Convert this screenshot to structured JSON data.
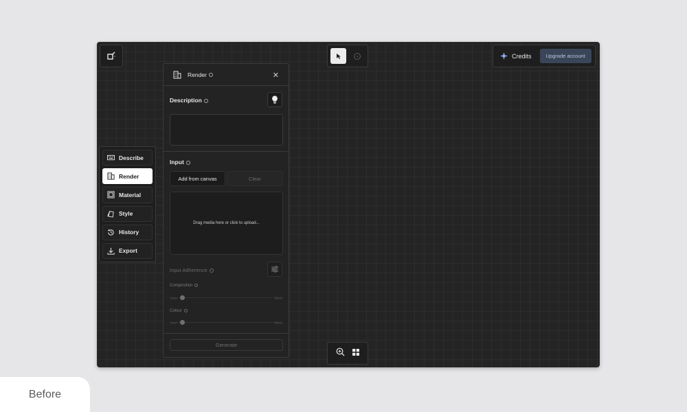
{
  "toolbar": {
    "tools": [
      {
        "name": "cursor-icon",
        "active": true
      },
      {
        "name": "target-icon",
        "active": false
      }
    ]
  },
  "header": {
    "credits_label": "Credits",
    "upgrade_label": "Upgrade account"
  },
  "sidebar": {
    "items": [
      {
        "label": "Describe",
        "icon": "keyboard-icon",
        "active": false
      },
      {
        "label": "Render",
        "icon": "building-icon",
        "active": true
      },
      {
        "label": "Material",
        "icon": "material-icon",
        "active": false
      },
      {
        "label": "Style",
        "icon": "style-icon",
        "active": false
      },
      {
        "label": "History",
        "icon": "history-icon",
        "active": false
      },
      {
        "label": "Export",
        "icon": "download-icon",
        "active": false
      }
    ]
  },
  "panel": {
    "title": "Render",
    "description_label": "Description",
    "description_value": "",
    "input_label": "Input",
    "add_from_canvas": "Add from canvas",
    "clear": "Clear",
    "dropzone_text": "Drag media here or click to upload...",
    "adherence_label": "Input Adherence",
    "composition_label": "Composition",
    "colour_label": "Colour",
    "slider_min": "Less",
    "slider_max": "More",
    "composition_value": 0,
    "colour_value": 0,
    "generate": "Generate"
  },
  "badge": {
    "label": "Before"
  },
  "colors": {
    "background": "#e6e6e8",
    "canvas": "#242424",
    "upgrade_bg": "#3a4658",
    "accent_star": "#8fb6ff"
  }
}
